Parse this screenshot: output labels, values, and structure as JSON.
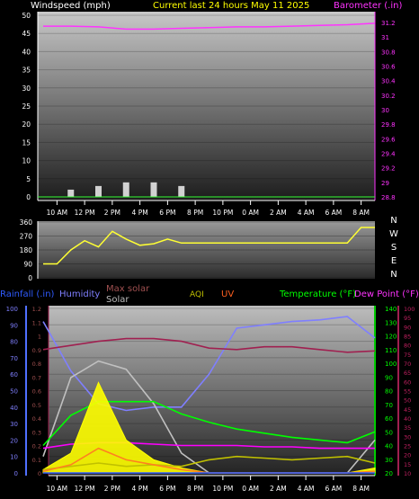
{
  "colors": {
    "wind": "#f0f0f0",
    "wind_avg": "#33ff33",
    "barometer": "#ff33ff",
    "direction": "#ffff33",
    "rain": "#2f5bff",
    "humidity": "#7f7fff",
    "max_solar": "#c0c0c0",
    "solar": "#ffff00",
    "uv": "#ff8020",
    "temperature": "#00ff00",
    "dew_point": "#ff00ff",
    "heat_index": "#a02050",
    "aqi": "#c0c000",
    "title_yellow": "#ffff00"
  },
  "header": {
    "wind_label": "Windspeed (mph)",
    "title": "Current last 24 hours May 11 2025",
    "baro_label": "Barometer (.in)"
  },
  "time_ticks": [
    "10 AM",
    "12 PM",
    "2 PM",
    "4 PM",
    "6 PM",
    "8 PM",
    "10 PM",
    "0 AM",
    "2 AM",
    "4 AM",
    "6 AM",
    "8 AM"
  ],
  "compass": [
    "N",
    "W",
    "S",
    "E",
    "N"
  ],
  "legend": {
    "rain": "Rainfall (.in)",
    "humidity": "Humidity",
    "max_solar": "Max solar",
    "solar": "Solar",
    "aqi": "AQI",
    "uv": "UV",
    "temperature": "Temperature (°F)",
    "dew_point": "Dew Point (°F)"
  },
  "chart_data": [
    {
      "type": "line",
      "title": "Current last 24 hours May 11 2025",
      "ylabel": "Windspeed (mph)",
      "ylim": [
        0,
        50
      ],
      "y_ticks": [
        "0",
        "5",
        "10",
        "15",
        "20",
        "25",
        "30",
        "35",
        "40",
        "45",
        "50"
      ],
      "y2label": "Barometer (.in)",
      "y2lim": [
        28.8,
        31.3
      ],
      "y2_ticks": [
        "28.8",
        "29",
        "29.2",
        "29.4",
        "29.6",
        "29.8",
        "30",
        "30.2",
        "30.4",
        "30.6",
        "30.8",
        "31",
        "31.2"
      ],
      "x": [
        9,
        11,
        13,
        15,
        17,
        19,
        21,
        23,
        25,
        27,
        29,
        31,
        33
      ],
      "series": [
        {
          "name": "Windspeed (mph)",
          "values": [
            0,
            2,
            3,
            4,
            4,
            3,
            0,
            0,
            0,
            0,
            0,
            0,
            0
          ]
        },
        {
          "name": "Barometer (.in)",
          "values": [
            31.15,
            31.15,
            31.14,
            31.11,
            31.11,
            31.12,
            31.13,
            31.14,
            31.14,
            31.15,
            31.16,
            31.17,
            31.19
          ]
        }
      ]
    },
    {
      "type": "line",
      "ylim": [
        0,
        360
      ],
      "y_ticks": [
        "0",
        "90",
        "180",
        "270",
        "360"
      ],
      "x": [
        9,
        10,
        11,
        12,
        13,
        14,
        15,
        16,
        17,
        18,
        19,
        20,
        22,
        24,
        26,
        28,
        30,
        31,
        32,
        33
      ],
      "series": [
        {
          "name": "",
          "values": [
            90,
            90,
            180,
            240,
            200,
            300,
            250,
            210,
            220,
            250,
            225,
            225,
            225,
            225,
            225,
            225,
            225,
            225,
            325,
            325
          ]
        }
      ]
    },
    {
      "type": "line",
      "x": [
        9,
        11,
        13,
        15,
        17,
        19,
        21,
        23,
        25,
        27,
        29,
        31,
        33
      ],
      "y_ticks_humidity": [
        "0",
        "10",
        "20",
        "30",
        "40",
        "50",
        "60",
        "70",
        "80",
        "90",
        "100"
      ],
      "y_ticks_rain": [
        "0",
        "0.1",
        "0.2",
        "0.3",
        "0.4",
        "0.5",
        "0.6",
        "0.7",
        "0.8",
        "0.9",
        "1",
        "1.1",
        "1.2"
      ],
      "y_ticks_temperature": [
        "20",
        "30",
        "40",
        "50",
        "60",
        "70",
        "80",
        "90",
        "100",
        "110",
        "120",
        "130",
        "140"
      ],
      "y_ticks_dewpoint": [
        "10",
        "15",
        "20",
        "25",
        "30",
        "35",
        "40",
        "45",
        "50",
        "55",
        "60",
        "65",
        "70",
        "75",
        "80",
        "85",
        "90",
        "95",
        "100"
      ],
      "series": [
        {
          "name": "Humidity",
          "axis": "humidity",
          "values": [
            92,
            62,
            42,
            38,
            40,
            40,
            60,
            88,
            90,
            92,
            93,
            95,
            82
          ]
        },
        {
          "name": "Max solar",
          "axis": "humidity",
          "values": [
            10,
            58,
            68,
            63,
            42,
            12,
            0,
            0,
            0,
            0,
            0,
            0,
            20
          ]
        },
        {
          "name": "Temperature (°F)",
          "axis": "temperature",
          "values": [
            40,
            62,
            72,
            72,
            72,
            63,
            57,
            52,
            49,
            46,
            44,
            42,
            50
          ]
        },
        {
          "name": "Dew Point (°F)",
          "axis": "temperature",
          "values": [
            38,
            41,
            42,
            42,
            41,
            40,
            40,
            40,
            39,
            39,
            38,
            38,
            38
          ]
        },
        {
          "name": "",
          "axis": "temperature",
          "values": [
            110,
            113,
            116,
            118,
            118,
            116,
            111,
            110,
            112,
            112,
            110,
            108,
            109
          ]
        },
        {
          "name": "Solar",
          "axis": "humidity",
          "values": [
            2,
            12,
            55,
            20,
            8,
            3,
            0,
            0,
            0,
            0,
            0,
            0,
            3
          ]
        },
        {
          "name": "AQI",
          "axis": "humidity",
          "values": [
            2,
            4,
            6,
            4,
            5,
            4,
            8,
            10,
            9,
            8,
            9,
            10,
            6
          ]
        },
        {
          "name": "UV",
          "axis": "humidity",
          "values": [
            1,
            5,
            15,
            8,
            5,
            2,
            0,
            0,
            0,
            0,
            0,
            0,
            1
          ]
        },
        {
          "name": "Rainfall (.in)",
          "axis": "rain",
          "values": [
            0,
            0,
            0,
            0,
            0,
            0,
            0,
            0,
            0,
            0,
            0,
            0,
            0
          ]
        }
      ]
    }
  ]
}
